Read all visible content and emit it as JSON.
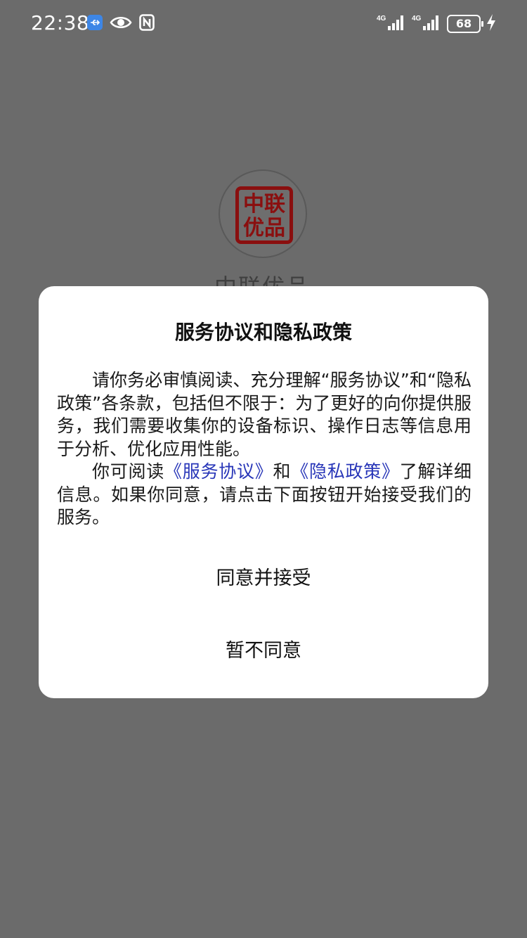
{
  "status_bar": {
    "time": "22:38",
    "network_left": "4G",
    "network_right": "4G",
    "battery": "68"
  },
  "background": {
    "logo_text_line1": "中联",
    "logo_text_line2": "优品",
    "app_name": "中联优品"
  },
  "dialog": {
    "title": "服务协议和隐私政策",
    "paragraph1": "请你务必审慎阅读、充分理解“服务协议”和“隐私政策”各条款，包括但不限于：为了更好的向你提供服务，我们需要收集你的设备标识、操作日志等信息用于分析、优化应用性能。",
    "p2_prefix": "你可阅读",
    "link_service": "《服务协议》",
    "p2_and": "和",
    "link_privacy": "《隐私政策》",
    "p2_suffix": "了解详细信息。如果你同意，请点击下面按钮开始接受我们的服务。",
    "agree_label": "同意并接受",
    "disagree_label": "暂不同意"
  },
  "colors": {
    "overlay": "#6b6b6b",
    "link": "#2836b8",
    "logo_red": "#8a0f0f"
  }
}
